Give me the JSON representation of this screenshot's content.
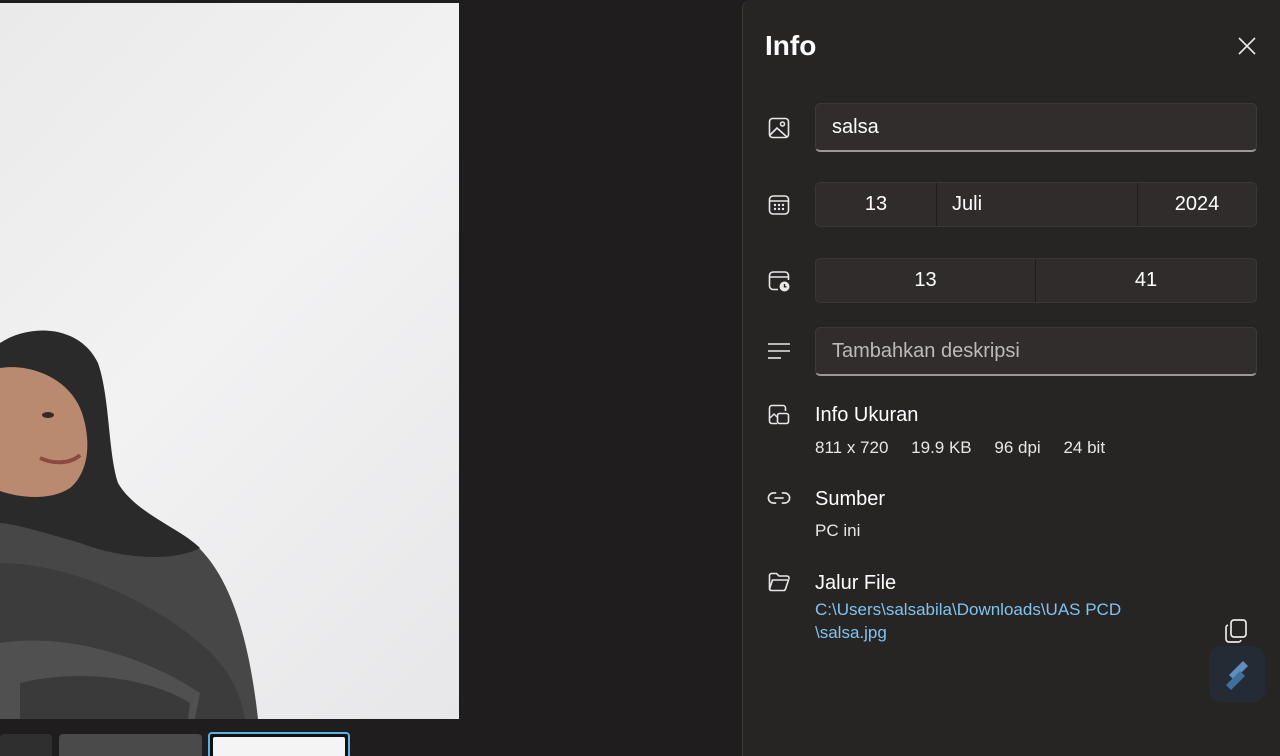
{
  "panel": {
    "title": "Info",
    "close_icon": "close-icon"
  },
  "fields": {
    "name_value": "salsa",
    "date": {
      "day": "13",
      "month": "Juli",
      "year": "2024"
    },
    "time": {
      "hour": "13",
      "minute": "41"
    },
    "description_placeholder": "Tambahkan deskripsi"
  },
  "size_info": {
    "title": "Info Ukuran",
    "dimensions": "811 x 720",
    "file_size": "19.9 KB",
    "dpi": "96 dpi",
    "bit_depth": "24 bit"
  },
  "source": {
    "title": "Sumber",
    "value": "PC ini"
  },
  "file_path": {
    "title": "Jalur File",
    "line1": "C:\\Users\\salsabila\\Downloads\\UAS PCD",
    "line2": "\\salsa.jpg"
  },
  "icons": {
    "name": "image-icon",
    "date": "calendar-icon",
    "time": "calendar-clock-icon",
    "description": "text-lines-icon",
    "size": "image-size-icon",
    "source": "link-icon",
    "path": "folder-icon",
    "copy": "copy-icon",
    "fab": "pen-icon"
  },
  "colors": {
    "panel_bg": "#272424",
    "link": "#7fc4f0",
    "selected_thumb_border": "#59b4e8"
  }
}
